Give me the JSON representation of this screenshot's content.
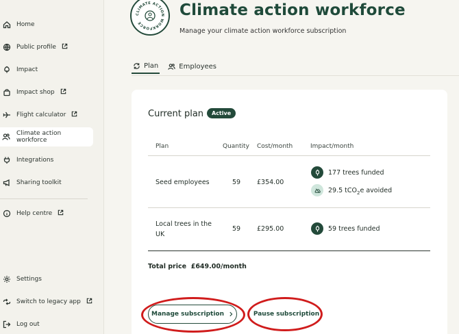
{
  "sidebar": {
    "items": [
      {
        "label": "Home",
        "icon": "home-icon",
        "external": false,
        "active": false
      },
      {
        "label": "Public profile",
        "icon": "globe-icon",
        "external": true,
        "active": false
      },
      {
        "label": "Impact",
        "icon": "leaf-icon",
        "external": false,
        "active": false
      },
      {
        "label": "Impact shop",
        "icon": "shopping-bag-icon",
        "external": true,
        "active": false
      },
      {
        "label": "Flight calculator",
        "icon": "plane-icon",
        "external": true,
        "active": false
      },
      {
        "label": "Climate action workforce",
        "icon": "people-icon",
        "external": false,
        "active": true
      },
      {
        "label": "Integrations",
        "icon": "plug-icon",
        "external": false,
        "active": false
      },
      {
        "label": "Sharing toolkit",
        "icon": "megaphone-icon",
        "external": false,
        "active": false
      },
      {
        "label": "Help centre",
        "icon": "info-icon",
        "external": true,
        "active": false
      }
    ],
    "bottom_items": [
      {
        "label": "Settings",
        "icon": "gear-icon",
        "external": false
      },
      {
        "label": "Switch to legacy app",
        "icon": "switch-icon",
        "external": true
      },
      {
        "label": "Log out",
        "icon": "logout-icon",
        "external": false
      }
    ]
  },
  "header": {
    "logo_text": "CLIMATE ACTION WORKFORCE",
    "title": "Climate action workforce",
    "subtitle": "Manage your climate action workforce subscription"
  },
  "tabs": [
    {
      "label": "Plan",
      "icon": "refresh-icon",
      "active": true
    },
    {
      "label": "Employees",
      "icon": "people-icon",
      "active": false
    }
  ],
  "plan_card": {
    "title": "Current plan",
    "status": "Active",
    "columns": [
      "Plan",
      "Quantity",
      "Cost/month",
      "Impact/month"
    ],
    "rows": [
      {
        "plan": "Seed employees",
        "quantity": "59",
        "cost": "£354.00",
        "impacts": [
          {
            "icon": "tree-icon",
            "style": "dark",
            "text": "177 trees funded"
          },
          {
            "icon": "cloud-icon",
            "style": "light",
            "text_prefix": "29.5 tCO",
            "text_sub": "2",
            "text_suffix": "e avoided"
          }
        ]
      },
      {
        "plan_line1": "Local trees in the",
        "plan_line2": "UK",
        "quantity": "59",
        "cost": "£295.00",
        "impacts": [
          {
            "icon": "tree-icon",
            "style": "dark",
            "text": "59 trees funded"
          }
        ]
      }
    ],
    "total_label": "Total price",
    "total_value": "£649.00/month",
    "manage_button": "Manage subscription",
    "pause_button": "Pause subscription"
  },
  "colors": {
    "brand_green": "#234a3a",
    "annotation_red": "#d01c1c",
    "light_green": "#cfe6dc"
  }
}
